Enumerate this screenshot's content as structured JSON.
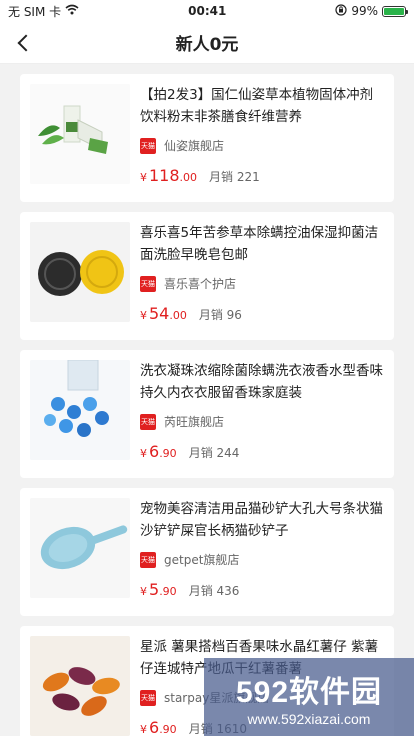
{
  "status_bar": {
    "carrier": "无 SIM 卡",
    "time": "00:41",
    "battery": "99%",
    "battery_level": 0.99
  },
  "nav": {
    "title": "新人0元"
  },
  "products": [
    {
      "title": "【拍2发3】国仁仙姿草本植物固体冲剂饮料粉末非茶膳食纤维营养",
      "badge": "天猫",
      "shop": "仙姿旗舰店",
      "currency": "¥",
      "price_int": "118",
      "price_dec": ".00",
      "sales": "月销 221"
    },
    {
      "title": "喜乐喜5年苦参草本除螨控油保湿抑菌洁面洗脸早晚皂包邮",
      "badge": "天猫",
      "shop": "喜乐喜个护店",
      "currency": "¥",
      "price_int": "54",
      "price_dec": ".00",
      "sales": "月销 96"
    },
    {
      "title": "洗衣凝珠浓缩除菌除螨洗衣液香水型香味持久内衣衣服留香珠家庭装",
      "badge": "天猫",
      "shop": "芮旺旗舰店",
      "currency": "¥",
      "price_int": "6",
      "price_dec": ".90",
      "sales": "月销 244"
    },
    {
      "title": "宠物美容清洁用品猫砂铲大孔大号条状猫沙铲铲屎官长柄猫砂铲子",
      "badge": "天猫",
      "shop": "getpet旗舰店",
      "currency": "¥",
      "price_int": "5",
      "price_dec": ".90",
      "sales": "月销 436"
    },
    {
      "title": "星派 薯果搭档百香果味水晶红薯仔 紫薯仔连城特产地瓜干红薯番薯",
      "badge": "天猫",
      "shop": "starpay星派旗舰店",
      "currency": "¥",
      "price_int": "6",
      "price_dec": ".90",
      "sales": "月销 1610"
    }
  ],
  "watermark": {
    "text": "592软件园",
    "url": "www.592xiazai.com"
  }
}
